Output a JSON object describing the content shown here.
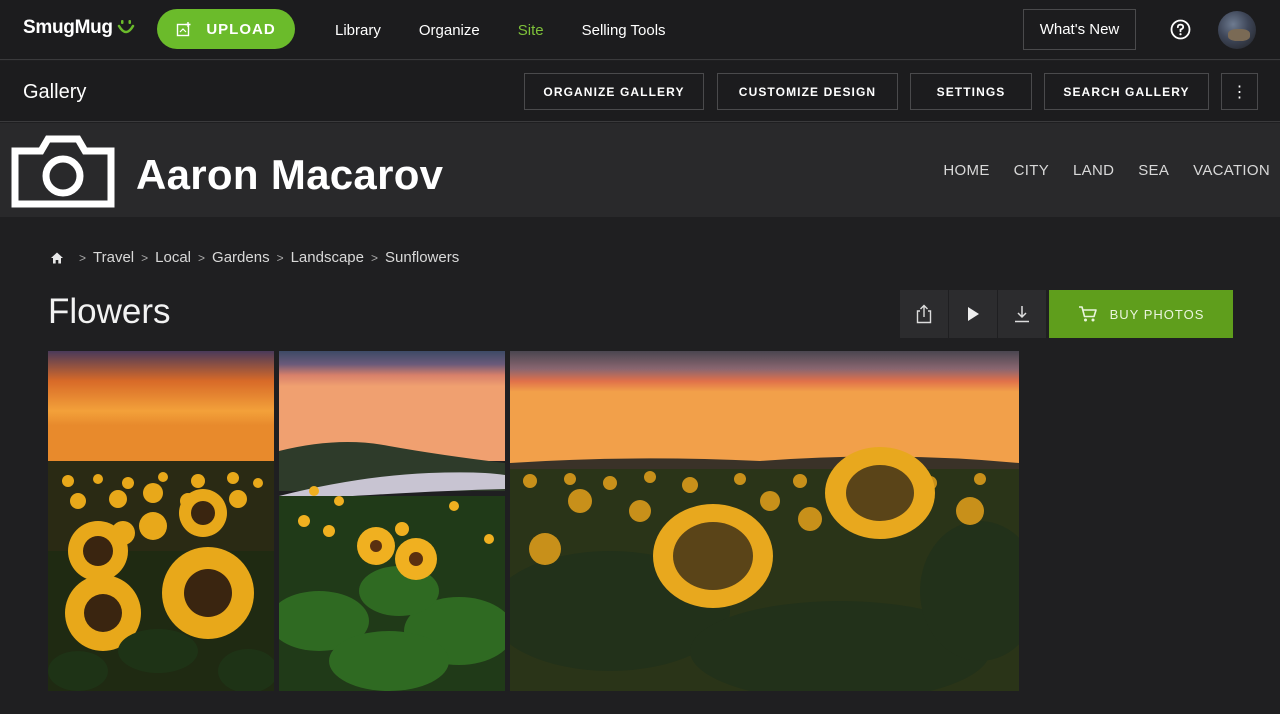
{
  "app": {
    "logo_text": "SmugMug",
    "upload_label": "UPLOAD",
    "nav": [
      "Library",
      "Organize",
      "Site",
      "Selling Tools"
    ],
    "active_nav": "Site",
    "whats_new": "What's New"
  },
  "subbar": {
    "title": "Gallery",
    "buttons": [
      "ORGANIZE GALLERY",
      "CUSTOMIZE DESIGN",
      "SETTINGS",
      "SEARCH GALLERY"
    ],
    "more_label": "⋮"
  },
  "site": {
    "name": "Aaron Macarov",
    "nav": [
      "HOME",
      "CITY",
      "LAND",
      "SEA",
      "VACATION"
    ]
  },
  "breadcrumb": [
    "Travel",
    "Local",
    "Gardens",
    "Landscape",
    "Sunflowers"
  ],
  "gallery": {
    "title": "Flowers",
    "buy_label": "BUY PHOTOS"
  },
  "icons": {
    "help": "help-icon",
    "home": "home-icon",
    "share": "share-icon",
    "play": "play-icon",
    "download": "download-icon",
    "cart": "cart-icon"
  },
  "colors": {
    "accent_green": "#6bbb2b",
    "buy_green": "#5f9e1c",
    "active_nav": "#7ec13a",
    "background": "#1f1f21"
  }
}
